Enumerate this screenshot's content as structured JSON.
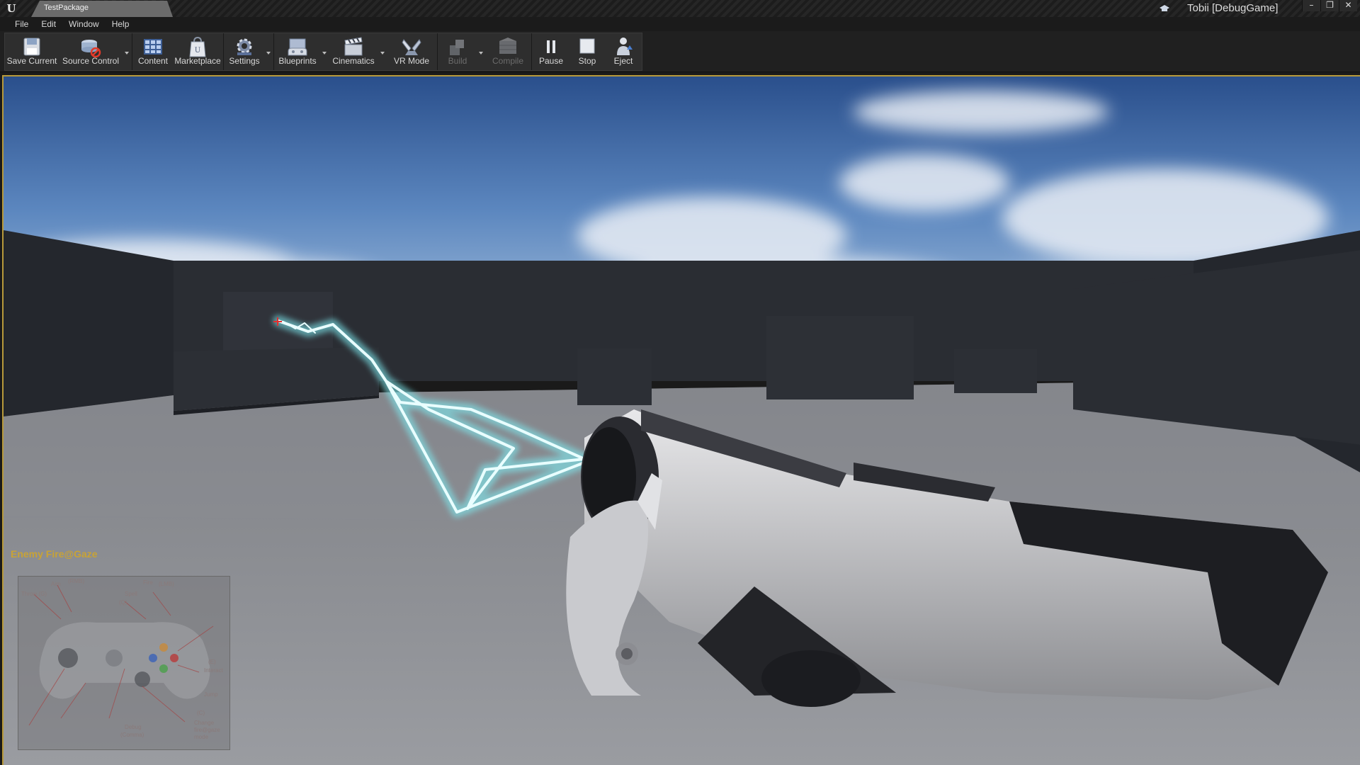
{
  "window": {
    "tab_title": "TestPackage",
    "session_label": "Tobii [DebugGame]",
    "controls": {
      "minimize": "–",
      "restore": "❐",
      "close": "✕"
    }
  },
  "menu": [
    "File",
    "Edit",
    "Window",
    "Help"
  ],
  "toolbar": {
    "save_current": "Save Current",
    "source_control": "Source Control",
    "content": "Content",
    "marketplace": "Marketplace",
    "settings": "Settings",
    "blueprints": "Blueprints",
    "cinematics": "Cinematics",
    "vr_mode": "VR Mode",
    "build": "Build",
    "compile": "Compile",
    "pause": "Pause",
    "stop": "Stop",
    "eject": "Eject"
  },
  "hud": {
    "mode_label": "Enemy Fire@Gaze",
    "controller": {
      "throw": "Throw (G)",
      "aim": "Aim",
      "rmb": "(RMB)",
      "spell": "Spell",
      "spell_key": "(Q)",
      "fire": "Fire",
      "lmb": "(LMB)",
      "e_key": "(E)",
      "interact": "Interact",
      "jump": "Jump",
      "c_key": "(C)",
      "change1": "Change",
      "change2": "fire@gaze",
      "change3": "mode",
      "debug": "Debug",
      "comma": "(Comma)"
    }
  },
  "colors": {
    "accent_border": "#b89a3a",
    "hud_label": "#c8a336",
    "beam": "#bdf5f7"
  }
}
